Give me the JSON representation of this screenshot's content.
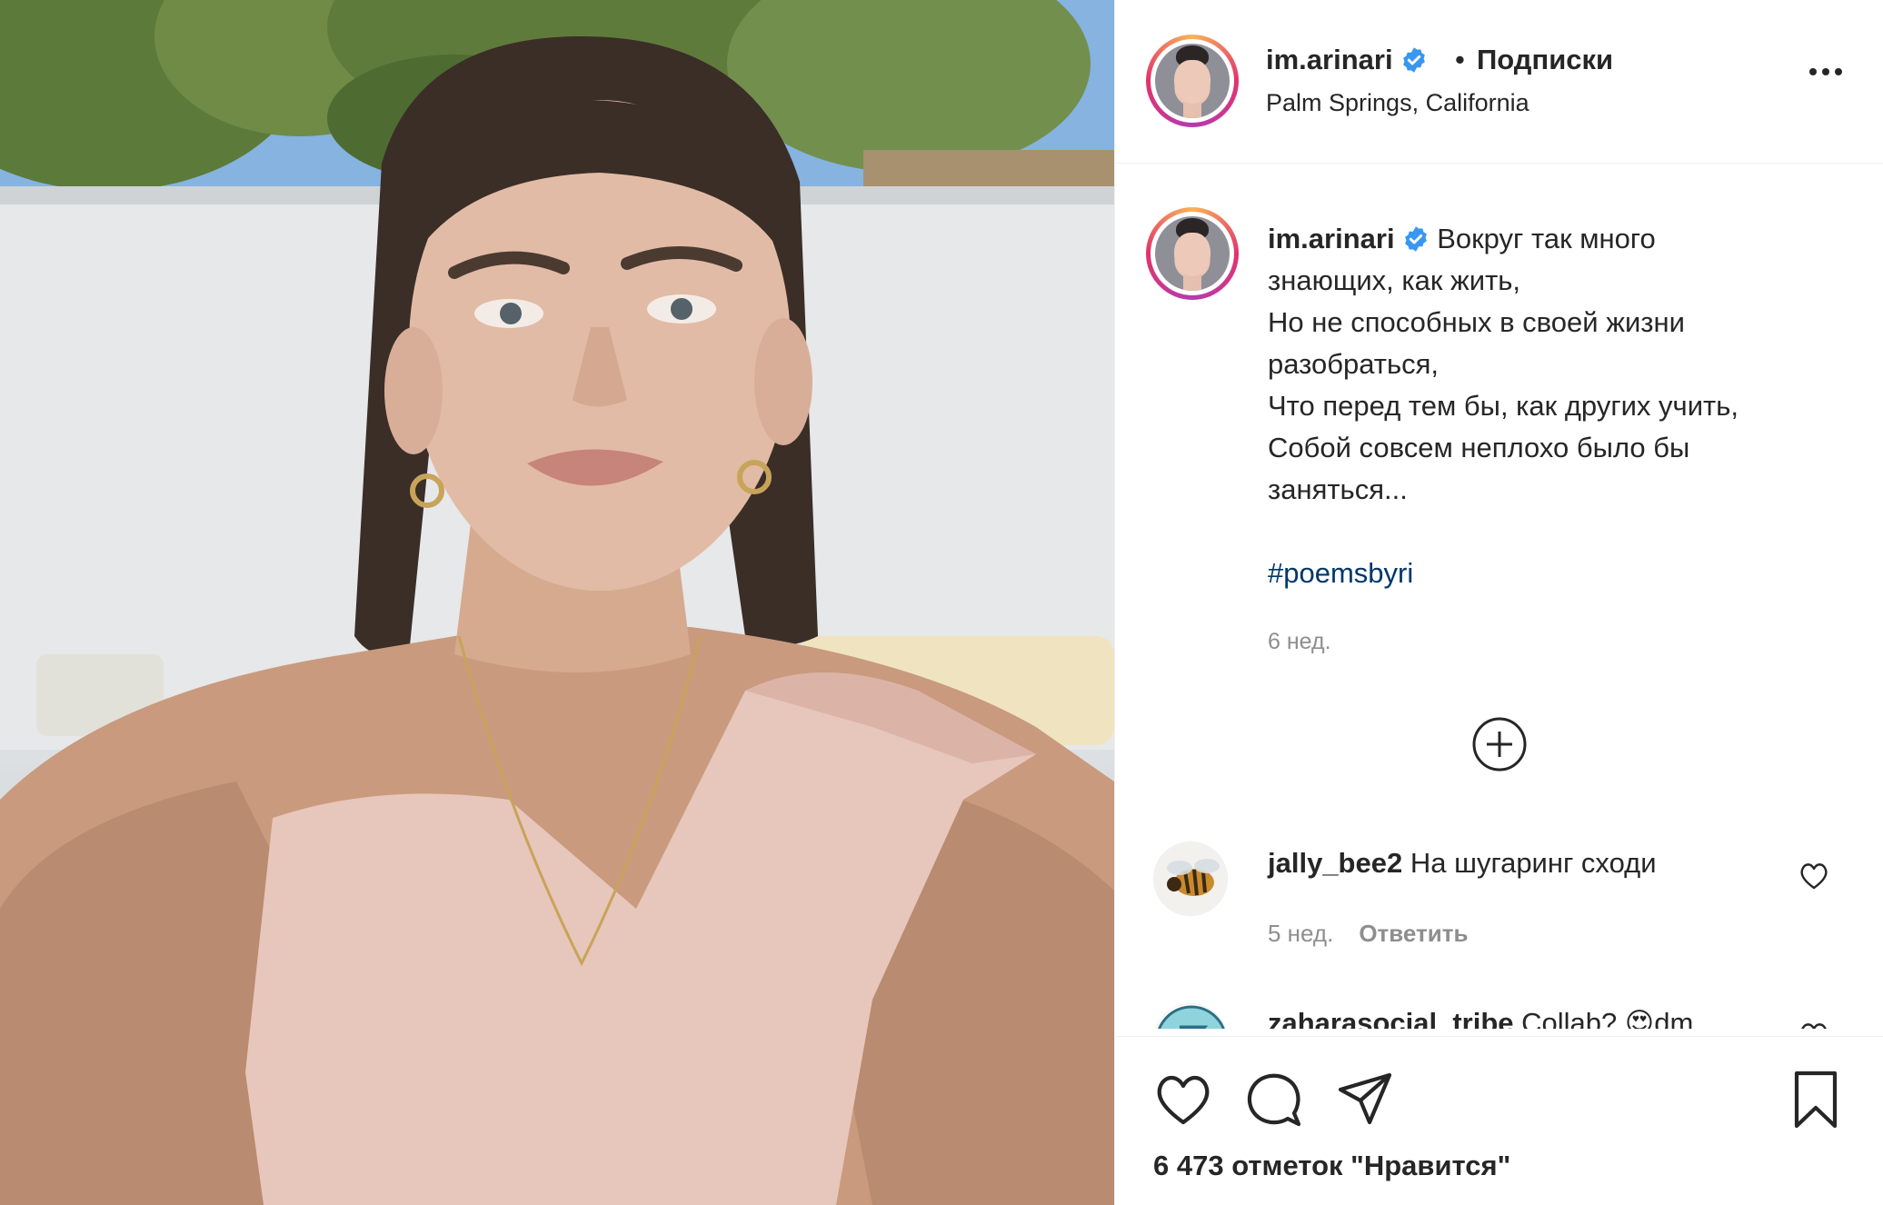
{
  "post": {
    "username": "im.arinari",
    "follow_status": "Подписки",
    "separator": "•",
    "location": "Palm Springs, California",
    "more_icon": "more-horizontal-icon"
  },
  "caption": {
    "username": "im.arinari",
    "text": "Вокруг так много\nзнающих, как жить,\nНо не способных в своей жизни\nразобраться,\nЧто перед тем бы, как других учить,\nСобой совсем неплохо было бы\nзаняться...",
    "hashtag": "#poemsbyri",
    "time": "6 нед."
  },
  "load_more_icon": "plus-circle-icon",
  "comments": [
    {
      "username": "jally_bee2",
      "text": "На шугаринг сходи",
      "time": "5 нед.",
      "reply_label": "Ответить"
    },
    {
      "username": "zaharasocial_tribe",
      "text": "Collab? 😍dm",
      "time": "",
      "reply_label": ""
    }
  ],
  "actions": {
    "like_icon": "heart-icon",
    "comment_icon": "comment-icon",
    "share_icon": "paper-plane-icon",
    "save_icon": "bookmark-icon",
    "likes_text": "6 473 отметок \"Нравится\""
  },
  "colors": {
    "text": "#262626",
    "secondary": "#8e8e8e",
    "hashtag": "#00376b",
    "verified": "#3897f0"
  }
}
